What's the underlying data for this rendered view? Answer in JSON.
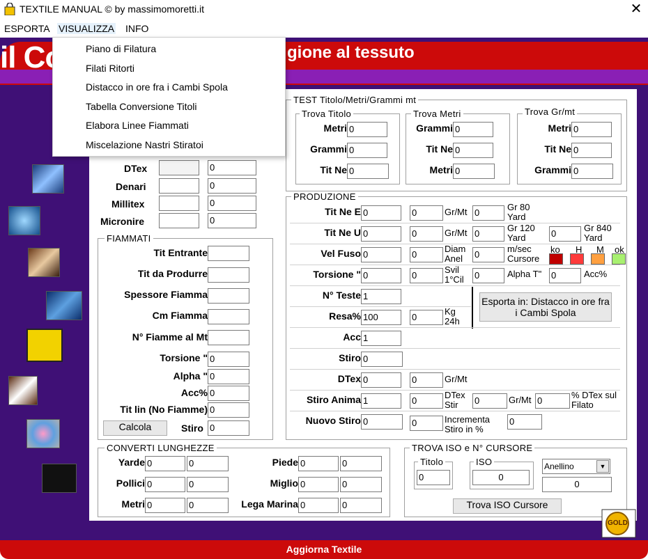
{
  "window": {
    "title": "TEXTILE MANUAL © by massimomoretti.it",
    "close": "✕"
  },
  "menubar": [
    "ESPORTA",
    "VISUALIZZA",
    "INFO"
  ],
  "dropdown": [
    "Piano di Filatura",
    "Filati Ritorti",
    "Distacco in ore fra i Cambi Spola",
    "Tabella Conversione Titoli",
    "Elabora Linee Fiammati",
    "Miscelazione Nastri Stiratoi"
  ],
  "banner": {
    "left": "il Co",
    "right": "gione al tessuto"
  },
  "footer": "Aggiorna Textile",
  "titles": {
    "dtex": "DTex",
    "denari": "Denari",
    "millitex": "Millitex",
    "micronire": "Micronire",
    "v0": "0"
  },
  "fiammati": {
    "title": "FIAMMATI",
    "labels": [
      "Tit Entrante",
      "Tit da Produrre",
      "Spessore Fiamma",
      "Cm Fiamma",
      "N° Fiamme al Mt",
      "Torsione \"",
      "Alpha \"",
      "Acc%",
      "Tit lin (No Fiamme)"
    ],
    "values": [
      "",
      "",
      "",
      "",
      "",
      "0",
      "0",
      "0",
      "0"
    ],
    "calcola": "Calcola",
    "stiro": "Stiro",
    "stiro_value": "0"
  },
  "test": {
    "title": "TEST Titolo/Metri/Grammi mt",
    "trova_titolo": {
      "title": "Trova Titolo",
      "labels": [
        "Metri",
        "Grammi",
        "Tit Ne"
      ],
      "values": [
        "0",
        "0",
        "0"
      ]
    },
    "trova_metri": {
      "title": "Trova Metri",
      "labels": [
        "Grammi",
        "Tit Ne",
        "Metri"
      ],
      "values": [
        "0",
        "0",
        "0"
      ]
    },
    "trova_gr": {
      "title": "Trova Gr/mt",
      "labels": [
        "Metri",
        "Tit Ne",
        "Grammi"
      ],
      "values": [
        "0",
        "0",
        "0"
      ]
    }
  },
  "produzione": {
    "title": "PRODUZIONE",
    "tit_ne_e": "Tit Ne E",
    "tit_ne_u": "Tit Ne U",
    "vel_fuso": "Vel Fuso",
    "torsione": "Torsione \"",
    "n_teste": "N° Teste",
    "resa": "Resa%",
    "acc": "Acc",
    "stiro": "Stiro",
    "dtex": "DTex",
    "stiro_anima": "Stiro Anima",
    "nuovo_stiro": "Nuovo Stiro",
    "grmt": "Gr/Mt",
    "gr80": "Gr 80 Yard",
    "gr120": "Gr 120 Yard",
    "gr840": "Gr 840 Yard",
    "diam_anel": "Diam Anel",
    "msec_cursore": "m/sec Cursore",
    "svil_1cil": "Svil 1°Cil",
    "alpha_t": "Alpha T\"",
    "accp": "Acc%",
    "kg24h": "Kg 24h",
    "dtex_stir": "DTex Stir",
    "pct_dtex": "% DTex sul Filato",
    "incrementa": "Incrementa Stiro in %",
    "ko": "ko",
    "h": "H",
    "m": "M",
    "ok": "ok",
    "esporta": "Esporta in: Distacco in ore fra i Cambi Spola",
    "v0": "0",
    "v1": "1",
    "v100": "100"
  },
  "converti": {
    "title": "CONVERTI LUNGHEZZE",
    "labels": [
      "Yarde",
      "Pollici",
      "Metri"
    ],
    "labels2": [
      "Piede",
      "Miglio",
      "Lega Marina"
    ]
  },
  "iso": {
    "title": "TROVA ISO e N° CURSORE",
    "titolo": "Titolo",
    "iso": "ISO",
    "anellino": "Anellino",
    "btn": "Trova ISO Cursore"
  },
  "gold": "GOLD",
  "colors": {
    "red": "#cc0a0a",
    "purple": "#3f1076",
    "violet": "#8a1fb5"
  }
}
